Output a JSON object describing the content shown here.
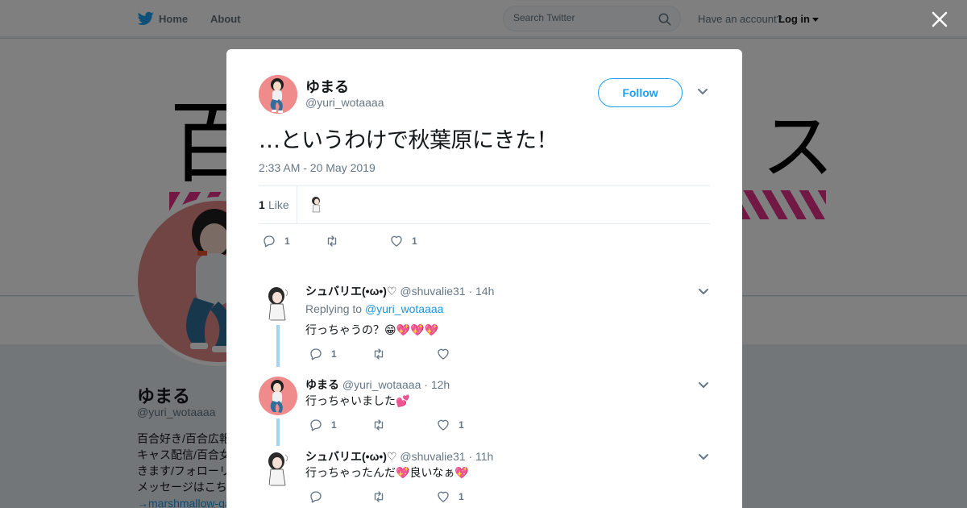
{
  "nav": {
    "home": "Home",
    "about": "About",
    "search_placeholder": "Search Twitter",
    "have_account": "Have an account?",
    "login": "Log in"
  },
  "background": {
    "banner_left_char": "百",
    "banner_right_char": "ス",
    "profile_name": "ゆまる",
    "profile_handle": "@yuri_wotaaaa",
    "bio_lines": [
      "百合好き/百合広報",
      "キャス配信/百合女",
      "きます/フォローリ",
      "メッセージはこち"
    ],
    "bio_link": "→marshmallow-qa"
  },
  "main_tweet": {
    "name": "ゆまる",
    "handle": "@yuri_wotaaaa",
    "follow_label": "Follow",
    "text": "…というわけで秋葉原にきた！",
    "timestamp": "2:33 AM - 20 May 2019",
    "likes_count": "1",
    "likes_label": "Like",
    "reply_count": "1",
    "retweet_count": "",
    "like_count": "1"
  },
  "replies": [
    {
      "name": "シュバリエ(•ω•)♡",
      "handle": "@shuvalie31",
      "time": "· 14h",
      "replying_label": "Replying to",
      "replying_to": "@yuri_wotaaaa",
      "text": "行っちゃうの？😁💖💖💖",
      "reply_count": "1",
      "like_count": ""
    },
    {
      "name": "ゆまる",
      "handle": "@yuri_wotaaaa",
      "time": "· 12h",
      "text": "行っちゃいました💕",
      "reply_count": "1",
      "like_count": "1"
    },
    {
      "name": "シュバリエ(•ω•)♡",
      "handle": "@shuvalie31",
      "time": "· 11h",
      "text": "行っちゃったんだ💖良いなぁ💖",
      "reply_count": "",
      "like_count": "1"
    }
  ],
  "colors": {
    "twitter_blue": "#1da1f2",
    "link_blue": "#1b95e0",
    "thread_line": "#a3d4f5",
    "banner_pink": "#e4318a"
  }
}
